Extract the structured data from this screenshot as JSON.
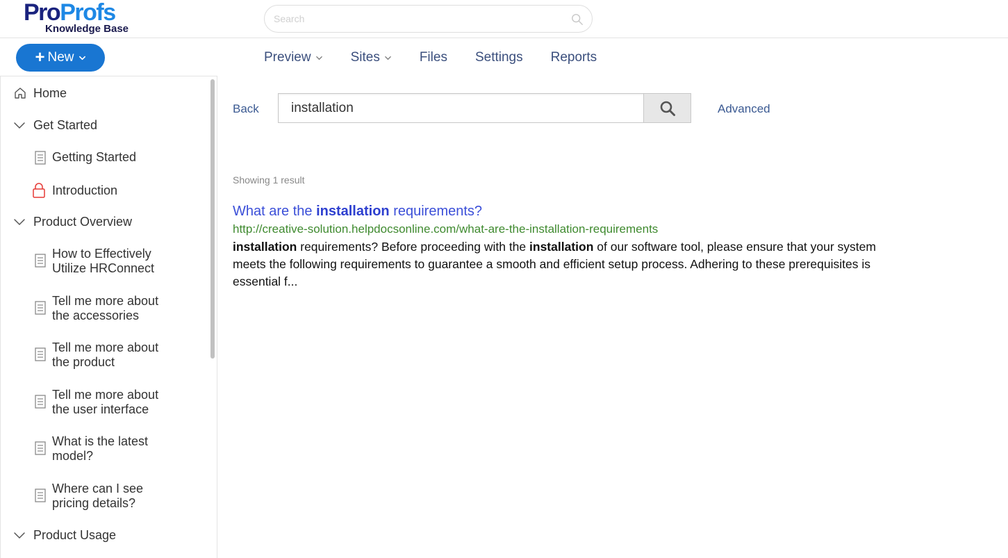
{
  "header": {
    "logo_pro": "Pro",
    "logo_profs": "Profs",
    "logo_subtitle": "Knowledge Base",
    "search_placeholder": "Search"
  },
  "new_button": {
    "label": "New"
  },
  "nav": [
    {
      "label": "Preview",
      "has_dropdown": true
    },
    {
      "label": "Sites",
      "has_dropdown": true
    },
    {
      "label": "Files",
      "has_dropdown": false
    },
    {
      "label": "Settings",
      "has_dropdown": false
    },
    {
      "label": "Reports",
      "has_dropdown": false
    }
  ],
  "sidebar": {
    "items": [
      {
        "label": "Home",
        "icon": "home-icon"
      },
      {
        "label": "Get Started",
        "icon": "chevron-down-icon"
      },
      {
        "label": "Getting Started",
        "icon": "document-icon"
      },
      {
        "label": "Introduction",
        "icon": "lock-icon"
      },
      {
        "label": "Product Overview",
        "icon": "chevron-down-icon"
      },
      {
        "label": "How to Effectively Utilize HRConnect",
        "icon": "document-icon"
      },
      {
        "label": "Tell me more about the accessories",
        "icon": "document-icon"
      },
      {
        "label": "Tell me more about the product",
        "icon": "document-icon"
      },
      {
        "label": "Tell me more about the user interface",
        "icon": "document-icon"
      },
      {
        "label": "What is the latest model?",
        "icon": "document-icon"
      },
      {
        "label": "Where can I see pricing details?",
        "icon": "document-icon"
      },
      {
        "label": "Product Usage",
        "icon": "chevron-down-icon"
      }
    ]
  },
  "search": {
    "back_label": "Back",
    "query": "installation",
    "advanced_label": "Advanced"
  },
  "results": {
    "summary": "Showing 1 result",
    "items": [
      {
        "title_prefix": "What are the ",
        "title_highlight": "installation",
        "title_suffix": " requirements?",
        "url": "http://creative-solution.helpdocsonline.com/what-are-the-installation-requirements",
        "snippet_1_bold": "installation",
        "snippet_2": " requirements? Before proceeding with the ",
        "snippet_3_bold": "installation",
        "snippet_4": " of our software tool, please ensure that your system meets the following requirements to guarantee a smooth and efficient setup process. Adhering to these prerequisites is essential f..."
      }
    ]
  },
  "colors": {
    "brand_dark": "#1a237e",
    "brand_blue": "#1e88e5",
    "new_button": "#1976d2",
    "link": "#3b4fd8",
    "url_green": "#3f8a2f",
    "lock_red": "#e53935"
  }
}
